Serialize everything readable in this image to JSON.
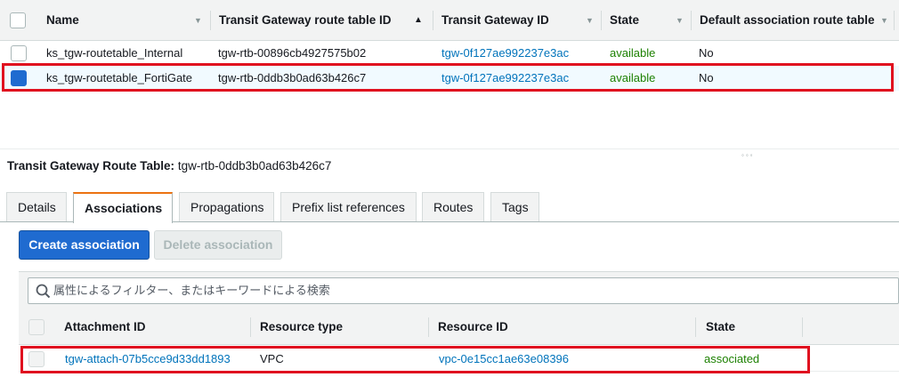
{
  "route_tables": {
    "columns": [
      "Name",
      "Transit Gateway route table ID",
      "Transit Gateway ID",
      "State",
      "Default association route table"
    ],
    "sorted_column_index": 1,
    "rows": [
      {
        "name": "ks_tgw-routetable_Internal",
        "route_table_id": "tgw-rtb-00896cb4927575b02",
        "tgw_id": "tgw-0f127ae992237e3ac",
        "state": "available",
        "default_association": "No",
        "selected": false
      },
      {
        "name": "ks_tgw-routetable_FortiGate",
        "route_table_id": "tgw-rtb-0ddb3b0ad63b426c7",
        "tgw_id": "tgw-0f127ae992237e3ac",
        "state": "available",
        "default_association": "No",
        "selected": true
      }
    ]
  },
  "detail": {
    "title_label": "Transit Gateway Route Table:",
    "title_value": "tgw-rtb-0ddb3b0ad63b426c7",
    "tabs": [
      "Details",
      "Associations",
      "Propagations",
      "Prefix list references",
      "Routes",
      "Tags"
    ],
    "active_tab": "Associations",
    "create_button": "Create association",
    "delete_button": "Delete association",
    "filter_placeholder": "属性によるフィルター、またはキーワードによる検索",
    "assoc_columns": [
      "Attachment ID",
      "Resource type",
      "Resource ID",
      "State"
    ],
    "assoc_rows": [
      {
        "attachment_id": "tgw-attach-07b5cce9d33dd1893",
        "resource_type": "VPC",
        "resource_id": "vpc-0e15cc1ae63e08396",
        "state": "associated"
      }
    ]
  },
  "colors": {
    "link": "#0073bb",
    "status_ok": "#1d8102",
    "primary": "#1f6bd0",
    "highlight": "#e0101f",
    "active_tab_accent": "#ec7211"
  },
  "icons": {
    "search": "search-icon",
    "sort": "sort-icon"
  }
}
